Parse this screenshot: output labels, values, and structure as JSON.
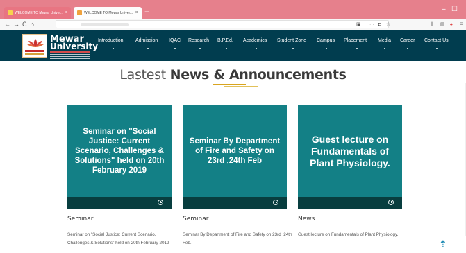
{
  "browser": {
    "tabs": [
      {
        "title": "WELCOME TO Mewar Univer...",
        "close": "×"
      },
      {
        "title": "WELCOME TO Mewar Univer...",
        "close": "×"
      }
    ],
    "new_tab": "+",
    "window_controls": {
      "minimize": "–",
      "maximize": "☐"
    },
    "toolbar_icons": {
      "back": "←",
      "forward": "→",
      "reload": "C",
      "home": "⌂",
      "menu": "≡"
    }
  },
  "site": {
    "logo": {
      "line1": "Mewar",
      "line2": "University"
    },
    "menu": [
      "Introduction",
      "Admission",
      "IQAC",
      "Research",
      "B.P.Ed.",
      "Academics",
      "Student Zone",
      "Campus",
      "Placement",
      "Media",
      "Career",
      "Contact Us"
    ]
  },
  "section": {
    "title_light": "Lastest",
    "title_bold": "News & Announcements"
  },
  "cards": [
    {
      "tile_text": "Seminar on \"Social Justice: Current Scenario, Challenges & Solutions\" held on 20th February 2019",
      "category": "Seminar",
      "description": "Seminar on \"Social Justice: Current Scenario, Challenges & Solutions\" held on 20th February 2019"
    },
    {
      "tile_text": "Seminar By Department of Fire and Safety on 23rd ,24th Feb",
      "category": "Seminar",
      "description": "Seminar By Department of Fire and Safety on 23rd ,24th Feb."
    },
    {
      "tile_text": "Guest lecture on Fundamentals of Plant Physiology.",
      "category": "News",
      "description": "Guest lecture on Fundamentals of Plant Physiology."
    }
  ],
  "colors": {
    "nav_bg": "#013d4f",
    "card_bg": "#138086",
    "card_footer": "#083e3f",
    "accent": "#d9a520",
    "browser_tabbar": "#e6808c"
  },
  "icons": [
    "clock-icon",
    "scroll-to-top-icon",
    "lotus-logo-icon"
  ]
}
